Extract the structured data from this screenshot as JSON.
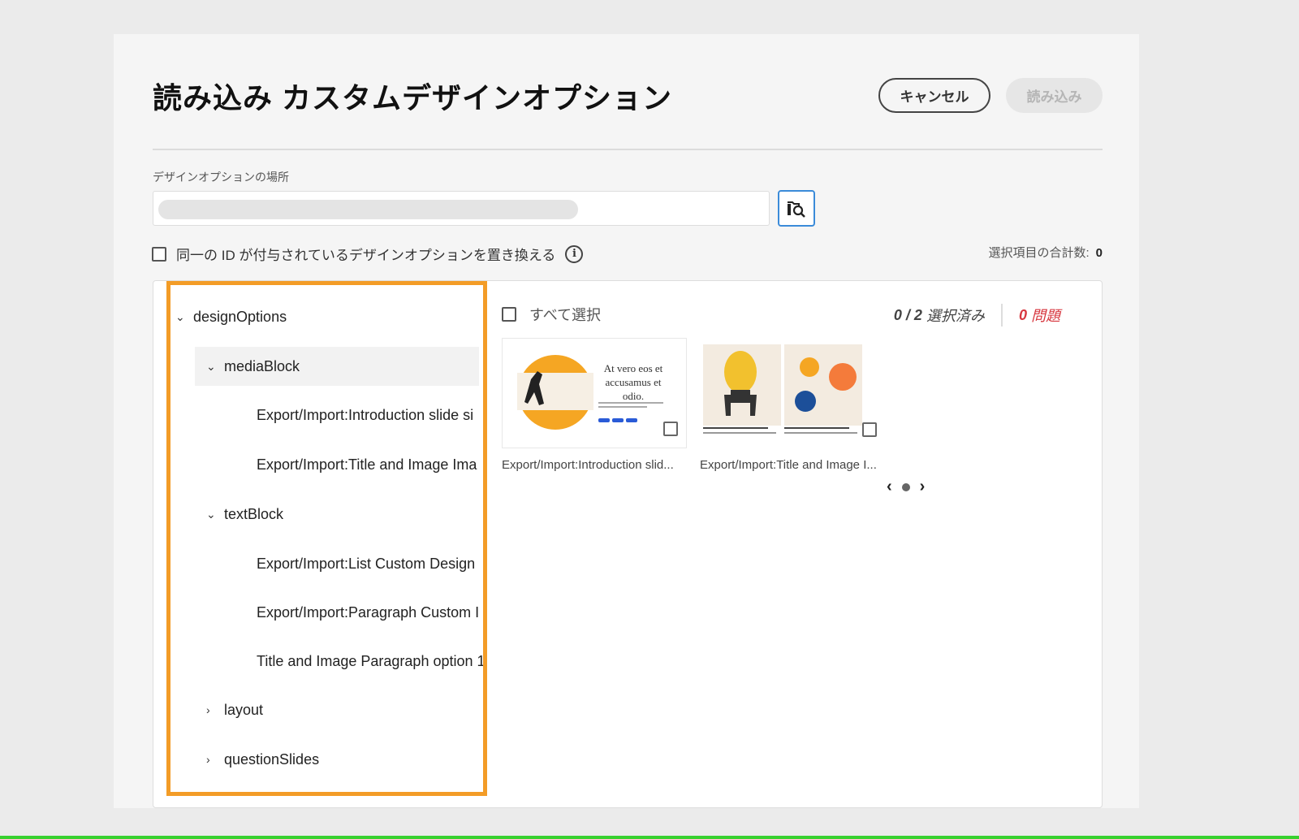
{
  "dialog": {
    "title": "読み込み カスタムデザインオプション",
    "cancel_label": "キャンセル",
    "import_label": "読み込み"
  },
  "location": {
    "label": "デザインオプションの場所",
    "value": ""
  },
  "replace": {
    "label": "同一の ID が付与されているデザインオプションを置き換える",
    "info_icon": "i"
  },
  "total": {
    "label": "選択項目の合計数:",
    "value": "0"
  },
  "tree": {
    "items": [
      {
        "label": "designOptions",
        "chev": "⌄"
      },
      {
        "label": "mediaBlock",
        "chev": "⌄"
      },
      {
        "label": "Export/Import:Introduction slide si",
        "chev": ""
      },
      {
        "label": "Export/Import:Title and Image Ima",
        "chev": ""
      },
      {
        "label": "textBlock",
        "chev": "⌄"
      },
      {
        "label": "Export/Import:List Custom Design",
        "chev": ""
      },
      {
        "label": "Export/Import:Paragraph Custom I",
        "chev": ""
      },
      {
        "label": "Title and Image Paragraph option 1",
        "chev": ""
      },
      {
        "label": "layout",
        "chev": "›"
      },
      {
        "label": "questionSlides",
        "chev": "›"
      }
    ]
  },
  "panel": {
    "select_all": "すべて選択",
    "selected": "0 / 2",
    "selected_suffix": "選択済み",
    "issues": "0",
    "issues_suffix": "問題",
    "cards": [
      {
        "caption": "Export/Import:Introduction slid...",
        "thumb_text": "At vero eos et accusamus et odio."
      },
      {
        "caption": "Export/Import:Title and Image I..."
      }
    ],
    "pager": {
      "prev": "‹",
      "next": "›"
    }
  },
  "colors": {
    "highlight": "#f39c27",
    "issues": "#d7373f",
    "accent": "#3b8bd9"
  }
}
